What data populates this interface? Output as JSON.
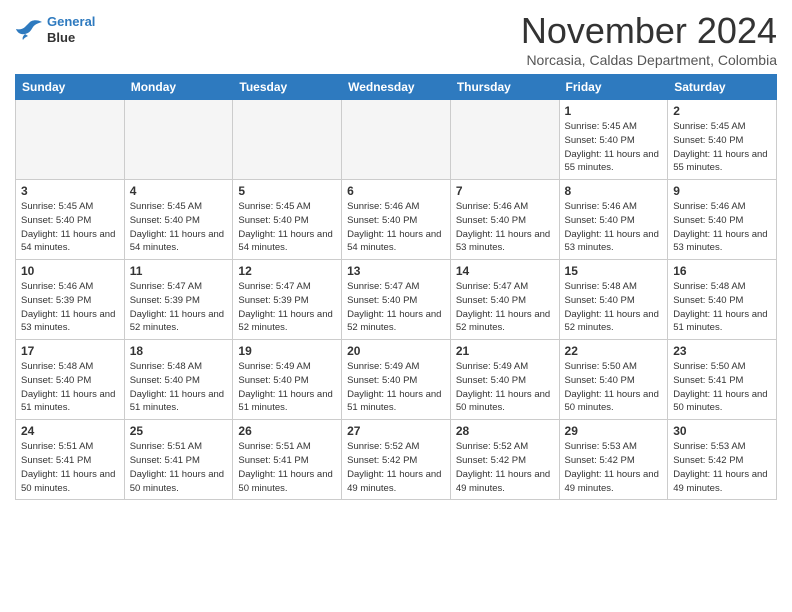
{
  "logo": {
    "line1": "General",
    "line2": "Blue"
  },
  "title": "November 2024",
  "location": "Norcasia, Caldas Department, Colombia",
  "days_of_week": [
    "Sunday",
    "Monday",
    "Tuesday",
    "Wednesday",
    "Thursday",
    "Friday",
    "Saturday"
  ],
  "weeks": [
    [
      {
        "day": "",
        "info": ""
      },
      {
        "day": "",
        "info": ""
      },
      {
        "day": "",
        "info": ""
      },
      {
        "day": "",
        "info": ""
      },
      {
        "day": "",
        "info": ""
      },
      {
        "day": "1",
        "info": "Sunrise: 5:45 AM\nSunset: 5:40 PM\nDaylight: 11 hours\nand 55 minutes."
      },
      {
        "day": "2",
        "info": "Sunrise: 5:45 AM\nSunset: 5:40 PM\nDaylight: 11 hours\nand 55 minutes."
      }
    ],
    [
      {
        "day": "3",
        "info": "Sunrise: 5:45 AM\nSunset: 5:40 PM\nDaylight: 11 hours\nand 54 minutes."
      },
      {
        "day": "4",
        "info": "Sunrise: 5:45 AM\nSunset: 5:40 PM\nDaylight: 11 hours\nand 54 minutes."
      },
      {
        "day": "5",
        "info": "Sunrise: 5:45 AM\nSunset: 5:40 PM\nDaylight: 11 hours\nand 54 minutes."
      },
      {
        "day": "6",
        "info": "Sunrise: 5:46 AM\nSunset: 5:40 PM\nDaylight: 11 hours\nand 54 minutes."
      },
      {
        "day": "7",
        "info": "Sunrise: 5:46 AM\nSunset: 5:40 PM\nDaylight: 11 hours\nand 53 minutes."
      },
      {
        "day": "8",
        "info": "Sunrise: 5:46 AM\nSunset: 5:40 PM\nDaylight: 11 hours\nand 53 minutes."
      },
      {
        "day": "9",
        "info": "Sunrise: 5:46 AM\nSunset: 5:40 PM\nDaylight: 11 hours\nand 53 minutes."
      }
    ],
    [
      {
        "day": "10",
        "info": "Sunrise: 5:46 AM\nSunset: 5:39 PM\nDaylight: 11 hours\nand 53 minutes."
      },
      {
        "day": "11",
        "info": "Sunrise: 5:47 AM\nSunset: 5:39 PM\nDaylight: 11 hours\nand 52 minutes."
      },
      {
        "day": "12",
        "info": "Sunrise: 5:47 AM\nSunset: 5:39 PM\nDaylight: 11 hours\nand 52 minutes."
      },
      {
        "day": "13",
        "info": "Sunrise: 5:47 AM\nSunset: 5:40 PM\nDaylight: 11 hours\nand 52 minutes."
      },
      {
        "day": "14",
        "info": "Sunrise: 5:47 AM\nSunset: 5:40 PM\nDaylight: 11 hours\nand 52 minutes."
      },
      {
        "day": "15",
        "info": "Sunrise: 5:48 AM\nSunset: 5:40 PM\nDaylight: 11 hours\nand 52 minutes."
      },
      {
        "day": "16",
        "info": "Sunrise: 5:48 AM\nSunset: 5:40 PM\nDaylight: 11 hours\nand 51 minutes."
      }
    ],
    [
      {
        "day": "17",
        "info": "Sunrise: 5:48 AM\nSunset: 5:40 PM\nDaylight: 11 hours\nand 51 minutes."
      },
      {
        "day": "18",
        "info": "Sunrise: 5:48 AM\nSunset: 5:40 PM\nDaylight: 11 hours\nand 51 minutes."
      },
      {
        "day": "19",
        "info": "Sunrise: 5:49 AM\nSunset: 5:40 PM\nDaylight: 11 hours\nand 51 minutes."
      },
      {
        "day": "20",
        "info": "Sunrise: 5:49 AM\nSunset: 5:40 PM\nDaylight: 11 hours\nand 51 minutes."
      },
      {
        "day": "21",
        "info": "Sunrise: 5:49 AM\nSunset: 5:40 PM\nDaylight: 11 hours\nand 50 minutes."
      },
      {
        "day": "22",
        "info": "Sunrise: 5:50 AM\nSunset: 5:40 PM\nDaylight: 11 hours\nand 50 minutes."
      },
      {
        "day": "23",
        "info": "Sunrise: 5:50 AM\nSunset: 5:41 PM\nDaylight: 11 hours\nand 50 minutes."
      }
    ],
    [
      {
        "day": "24",
        "info": "Sunrise: 5:51 AM\nSunset: 5:41 PM\nDaylight: 11 hours\nand 50 minutes."
      },
      {
        "day": "25",
        "info": "Sunrise: 5:51 AM\nSunset: 5:41 PM\nDaylight: 11 hours\nand 50 minutes."
      },
      {
        "day": "26",
        "info": "Sunrise: 5:51 AM\nSunset: 5:41 PM\nDaylight: 11 hours\nand 50 minutes."
      },
      {
        "day": "27",
        "info": "Sunrise: 5:52 AM\nSunset: 5:42 PM\nDaylight: 11 hours\nand 49 minutes."
      },
      {
        "day": "28",
        "info": "Sunrise: 5:52 AM\nSunset: 5:42 PM\nDaylight: 11 hours\nand 49 minutes."
      },
      {
        "day": "29",
        "info": "Sunrise: 5:53 AM\nSunset: 5:42 PM\nDaylight: 11 hours\nand 49 minutes."
      },
      {
        "day": "30",
        "info": "Sunrise: 5:53 AM\nSunset: 5:42 PM\nDaylight: 11 hours\nand 49 minutes."
      }
    ]
  ]
}
